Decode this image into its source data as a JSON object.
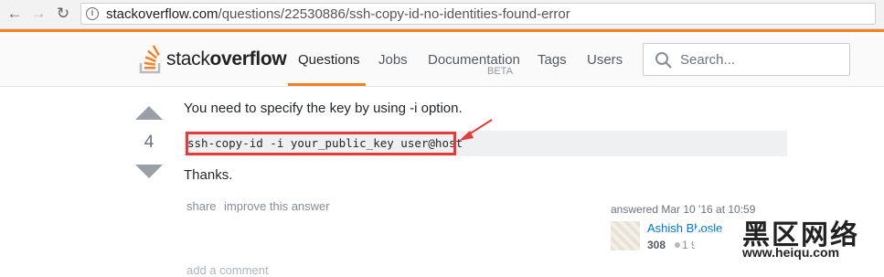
{
  "browser": {
    "url_host": "stackoverflow.com",
    "url_path": "/questions/22530886/ssh-copy-id-no-identities-found-error",
    "back_icon": "arrow-left-icon",
    "forward_icon": "arrow-right-icon",
    "reload_icon": "reload-icon",
    "info_icon": "info-icon"
  },
  "header": {
    "logo_light": "stack",
    "logo_bold": "overflow",
    "nav": [
      {
        "label": "Questions"
      },
      {
        "label": "Jobs"
      },
      {
        "label": "Documentation"
      },
      {
        "label": "Tags"
      },
      {
        "label": "Users"
      }
    ],
    "documentation_sub": "BETA",
    "search_placeholder": "Search...",
    "accent": "#f48024"
  },
  "answer": {
    "vote_count": "4",
    "line1": "You need to specify the key by using -i option.",
    "code": "ssh-copy-id -i your_public_key user@host",
    "line2": "Thanks.",
    "menu": {
      "share": "share",
      "improve": "improve this answer"
    },
    "signature": {
      "answered": "answered Mar 10 '16 at 10:59",
      "user": "Ashish Bhosle",
      "reputation": "308",
      "badge_count": "1 9"
    },
    "add_comment": "add a comment",
    "highlight_color": "#e53a3a"
  },
  "watermark": {
    "title": "黑区网络",
    "url": "www.heiqu.com"
  }
}
